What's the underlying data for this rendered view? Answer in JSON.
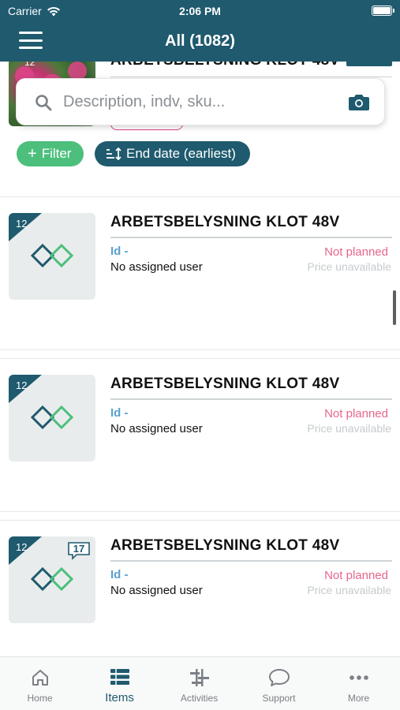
{
  "status_bar": {
    "carrier": "Carrier",
    "time": "2:06 PM"
  },
  "header": {
    "title": "All (1082)"
  },
  "partial_item": {
    "title": "ARBETSBELYSNING KLOT 48V",
    "badge": "12"
  },
  "search": {
    "placeholder": "Description, indv, sku..."
  },
  "chips": {
    "filter_label": "Filter",
    "sort_label": "End date (earliest)"
  },
  "items": [
    {
      "badge": "12",
      "title": "ARBETSBELYSNING KLOT 48V",
      "id": "Id -",
      "assignee": "No assigned user",
      "status": "Not planned",
      "price": "Price unavailable",
      "messages": ""
    },
    {
      "badge": "12",
      "title": "ARBETSBELYSNING KLOT 48V",
      "id": "Id -",
      "assignee": "No assigned user",
      "status": "Not planned",
      "price": "Price unavailable",
      "messages": ""
    },
    {
      "badge": "12",
      "title": "ARBETSBELYSNING KLOT 48V",
      "id": "Id -",
      "assignee": "No assigned user",
      "status": "Not planned",
      "price": "Price unavailable",
      "messages": "17"
    }
  ],
  "tabs": [
    {
      "label": "Home",
      "icon": "home-icon"
    },
    {
      "label": "Items",
      "icon": "items-icon",
      "active": true
    },
    {
      "label": "Activities",
      "icon": "activities-icon"
    },
    {
      "label": "Support",
      "icon": "support-icon"
    },
    {
      "label": "More",
      "icon": "more-icon"
    }
  ],
  "colors": {
    "primary": "#1f5a6e",
    "accent_green": "#4cbf7c",
    "status_pink": "#e8668b",
    "id_blue": "#5aa0d0"
  }
}
